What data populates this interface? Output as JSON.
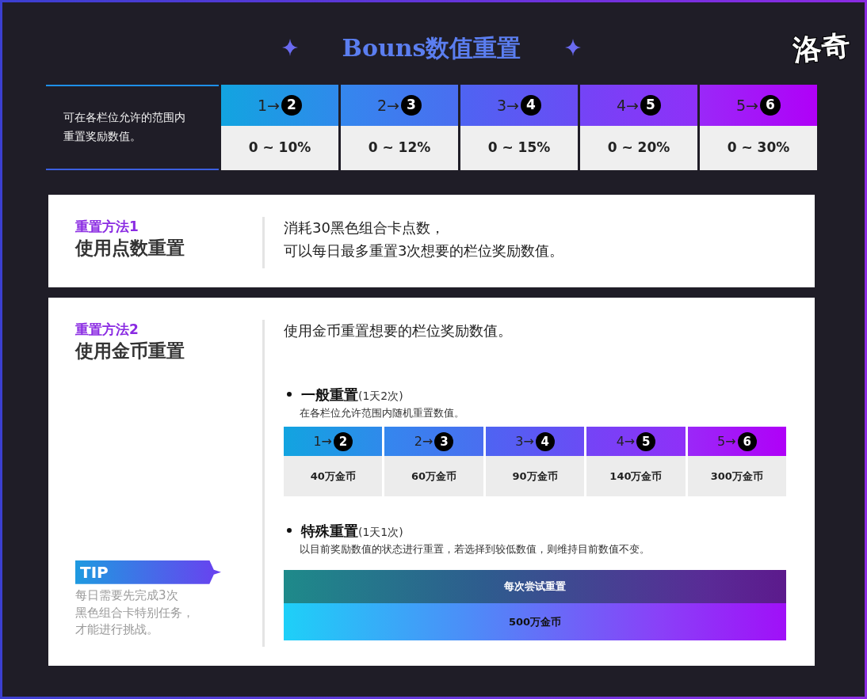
{
  "title": "Bouns数值重置",
  "logo": "洛奇",
  "range_table": {
    "description": [
      "可在各栏位允许的范围内",
      "重置奖励数值。"
    ],
    "tiers": [
      {
        "from": "1",
        "arrow": "→",
        "to": "2",
        "range": "0 ~ 10%"
      },
      {
        "from": "2",
        "arrow": "→",
        "to": "3",
        "range": "0 ~ 12%"
      },
      {
        "from": "3",
        "arrow": "→",
        "to": "4",
        "range": "0 ~ 15%"
      },
      {
        "from": "4",
        "arrow": "→",
        "to": "5",
        "range": "0 ~ 20%"
      },
      {
        "from": "5",
        "arrow": "→",
        "to": "6",
        "range": "0 ~ 30%"
      }
    ]
  },
  "methods": [
    {
      "tag": "重置方法1",
      "name": "使用点数重置",
      "description": [
        "消耗30黑色组合卡点数，",
        "可以每日最多重置3次想要的栏位奖励数值。"
      ]
    },
    {
      "tag": "重置方法2",
      "name": "使用金币重置",
      "description": [
        "使用金币重置想要的栏位奖励数值。"
      ],
      "options": [
        {
          "kind": "tiers",
          "name": "一般重置",
          "limit": "(1天2次)",
          "note": "在各栏位允许范围内随机重置数值。",
          "tiers": [
            {
              "from": "1",
              "arrow": "→",
              "to": "2",
              "cost": "40万金币"
            },
            {
              "from": "2",
              "arrow": "→",
              "to": "3",
              "cost": "60万金币"
            },
            {
              "from": "3",
              "arrow": "→",
              "to": "4",
              "cost": "90万金币"
            },
            {
              "from": "4",
              "arrow": "→",
              "to": "5",
              "cost": "140万金币"
            },
            {
              "from": "5",
              "arrow": "→",
              "to": "6",
              "cost": "300万金币"
            }
          ]
        },
        {
          "kind": "single",
          "name": "特殊重置",
          "limit": "(1天1次)",
          "note": "以目前奖励数值的状态进行重置，若选择到较低数值，则维持目前数值不变。",
          "header": "每次尝试重置",
          "cost": "500万金币"
        }
      ],
      "tip": {
        "label": "TIP",
        "text": [
          "每日需要先完成3次",
          "黑色组合卡特别任务，",
          "才能进行挑战。"
        ]
      }
    }
  ]
}
